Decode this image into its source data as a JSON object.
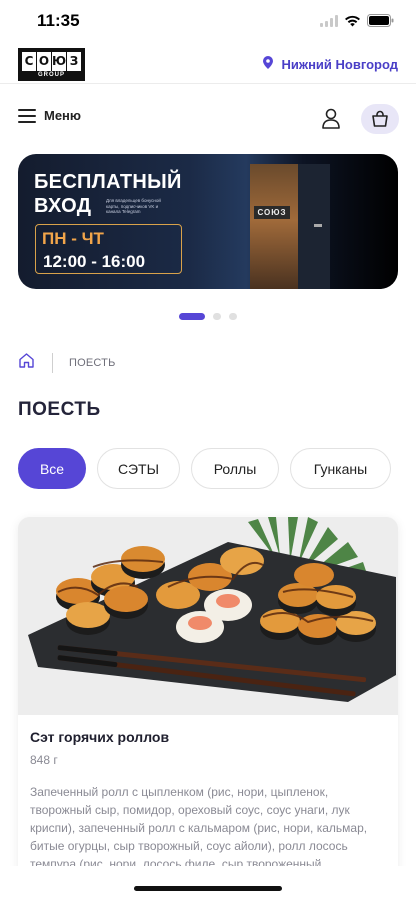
{
  "status_bar": {
    "time": "11:35"
  },
  "header": {
    "logo": {
      "letters": [
        "С",
        "О",
        "Ю",
        "З"
      ],
      "subtitle": "GROUP"
    },
    "city": "Нижний Новгород"
  },
  "nav": {
    "menu_label": "Меню"
  },
  "banner": {
    "title_line1": "БЕСПЛАТНЫЙ",
    "title_line2": "ВХОД",
    "small_text": "Для владельцев бонусной карты, подписчиков VK и канала Telegram",
    "days": "ПН - ЧТ",
    "hours": "12:00 - 16:00",
    "door_sign": "СОЮЗ"
  },
  "carousel": {
    "total": 3,
    "active": 1
  },
  "breadcrumb": {
    "current": "ПОЕСТЬ"
  },
  "page_title": "ПОЕСТЬ",
  "categories": [
    {
      "label": "Все",
      "active": true
    },
    {
      "label": "СЭТЫ",
      "active": false
    },
    {
      "label": "Роллы",
      "active": false
    },
    {
      "label": "Гунканы",
      "active": false
    }
  ],
  "product": {
    "title": "Сэт горячих роллов",
    "weight": "848 г",
    "description": "Запеченный ролл с цыпленком (рис, нори, цыпленок, творожный сыр, помидор, ореховый соус, соус унаги, лук криспи), запеченный ролл с кальмаром (рис, нори, кальмар, битые огурцы, сыр творожный, соус айоли), ролл лосось темпура (рис, нори, лосось филе, сыр твороженный,"
  },
  "colors": {
    "accent": "#5646d6",
    "accent_light": "#e8e6f7",
    "city_text": "#4a3fc7",
    "banner_accent": "#f2a54a"
  }
}
